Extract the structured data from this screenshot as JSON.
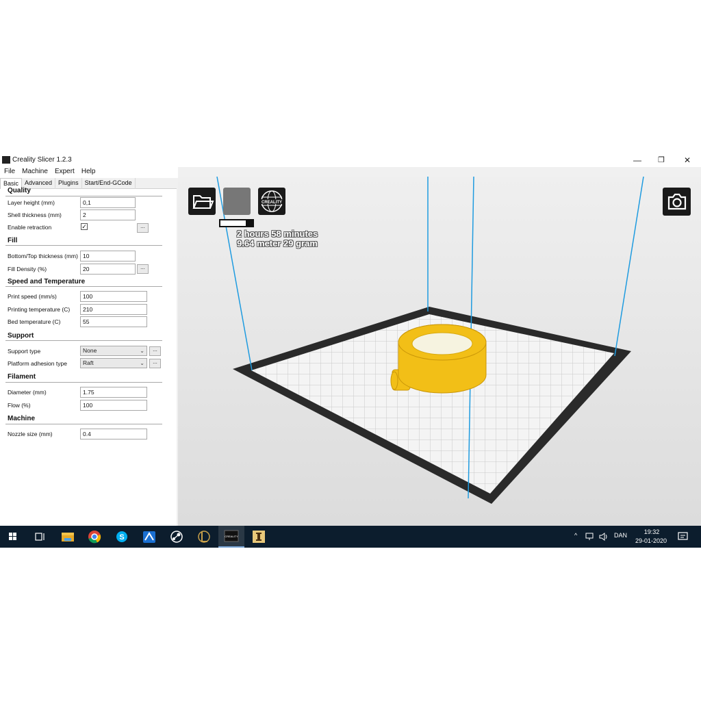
{
  "window": {
    "title": "Creality Slicer 1.2.3",
    "min_glyph": "—",
    "max_glyph": "❐",
    "close_glyph": "✕"
  },
  "menu": [
    "File",
    "Machine",
    "Expert",
    "Help"
  ],
  "tabs": [
    "Basic",
    "Advanced",
    "Plugins",
    "Start/End-GCode"
  ],
  "quality": {
    "title": "Quality",
    "layer_height_label": "Layer height (mm)",
    "layer_height": "0,1",
    "shell_label": "Shell thickness (mm)",
    "shell": "2",
    "retraction_label": "Enable retraction",
    "retraction_checked": "✓"
  },
  "fill": {
    "title": "Fill",
    "bottom_top_label": "Bottom/Top thickness (mm)",
    "bottom_top": "10",
    "density_label": "Fill Density (%)",
    "density": "20"
  },
  "speed": {
    "title": "Speed and Temperature",
    "print_speed_label": "Print speed (mm/s)",
    "print_speed": "100",
    "print_temp_label": "Printing temperature (C)",
    "print_temp": "210",
    "bed_temp_label": "Bed temperature (C)",
    "bed_temp": "55"
  },
  "support": {
    "title": "Support",
    "type_label": "Support type",
    "type": "None",
    "adhesion_label": "Platform adhesion type",
    "adhesion": "Raft"
  },
  "filament": {
    "title": "Filament",
    "diameter_label": "Diameter (mm)",
    "diameter": "1.75",
    "flow_label": "Flow (%)",
    "flow": "100"
  },
  "machine": {
    "title": "Machine",
    "nozzle_label": "Nozzle size (mm)",
    "nozzle": "0.4"
  },
  "dots_label": "...",
  "viewport": {
    "print_time": "2 hours 58 minutes",
    "material": "9.64 meter 29 gram",
    "slice_progress": 0.78,
    "logo_text": "CREALITY",
    "model_color": "#f2bf17",
    "bed_border_color": "#2a2a2a",
    "frame_line_color": "#1e9be0"
  },
  "taskbar": {
    "language": "DAN",
    "time": "19:32",
    "date": "29-01-2020",
    "tray_up": "^",
    "active_app_label": "CREALITY"
  }
}
